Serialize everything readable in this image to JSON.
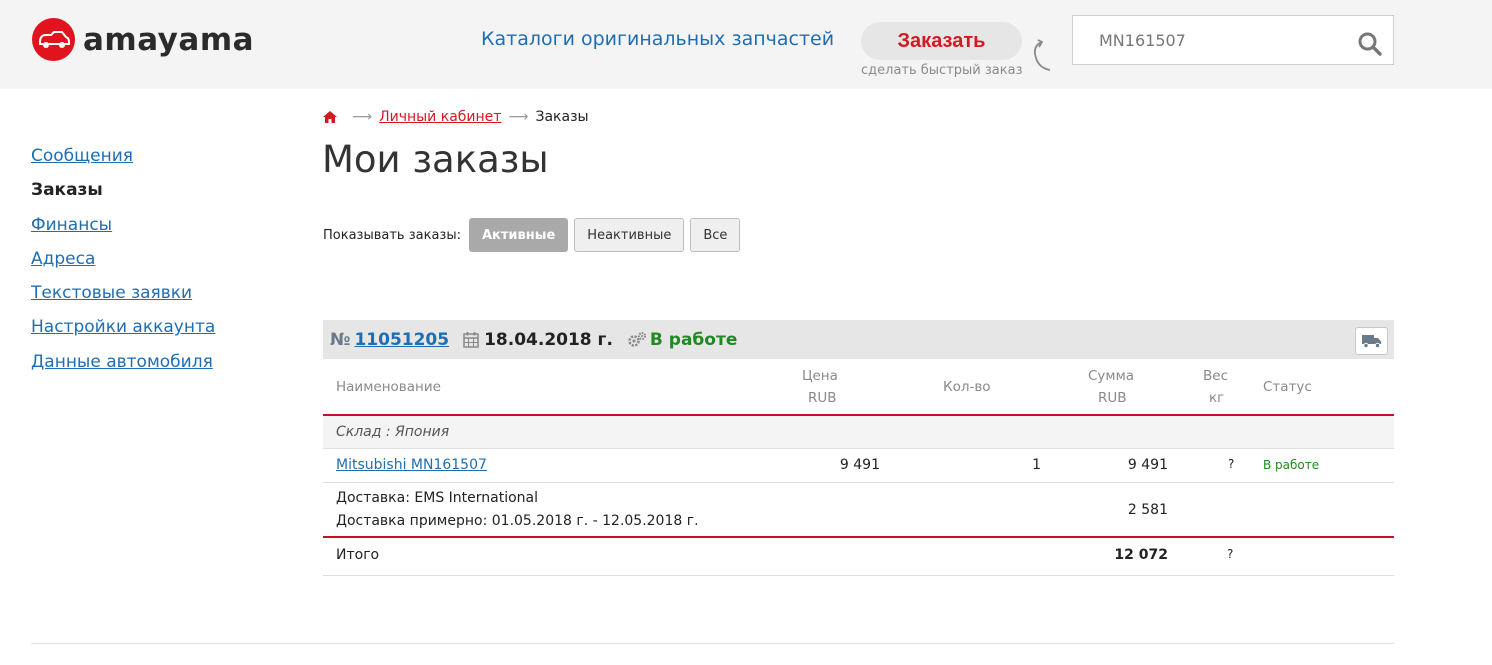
{
  "header": {
    "logo_text": "amayama",
    "catalog_link": "Каталоги оригинальных запчастей",
    "order_button": "Заказать",
    "order_hint": "сделать быстрый заказ",
    "search_value": "MN161507"
  },
  "sidebar": {
    "items": [
      {
        "label": "Сообщения"
      },
      {
        "label": "Заказы"
      },
      {
        "label": "Финансы"
      },
      {
        "label": "Адреса"
      },
      {
        "label": "Текстовые заявки"
      },
      {
        "label": "Настройки аккаунта"
      },
      {
        "label": "Данные автомобиля"
      }
    ]
  },
  "breadcrumb": {
    "cabinet": "Личный кабинет",
    "current": "Заказы"
  },
  "page_title": "Мои заказы",
  "filter": {
    "label": "Показывать заказы:",
    "active": "Активные",
    "inactive": "Неактивные",
    "all": "Все"
  },
  "order": {
    "no_prefix": "№",
    "number": "11051205",
    "date": "18.04.2018 г.",
    "status": "В работе"
  },
  "table": {
    "headers": {
      "name": "Наименование",
      "price": "Цена",
      "price_unit": "RUB",
      "qty": "Кол-во",
      "sum": "Сумма",
      "sum_unit": "RUB",
      "weight": "Вес",
      "weight_unit": "кг",
      "status": "Статус"
    },
    "warehouse": "Склад : Япония",
    "item": {
      "name": "Mitsubishi MN161507",
      "price": "9 491",
      "qty": "1",
      "sum": "9 491",
      "weight": "?",
      "status": "В работе"
    },
    "delivery": {
      "line1": "Доставка: EMS International",
      "line2": "Доставка примерно: 01.05.2018 г. - 12.05.2018 г.",
      "sum": "2 581"
    },
    "total": {
      "label": "Итого",
      "sum": "12 072",
      "weight": "?"
    }
  },
  "colors": {
    "brand_red": "#e0141e",
    "link_blue": "#1f6db3",
    "status_green": "#1f8a1f"
  }
}
